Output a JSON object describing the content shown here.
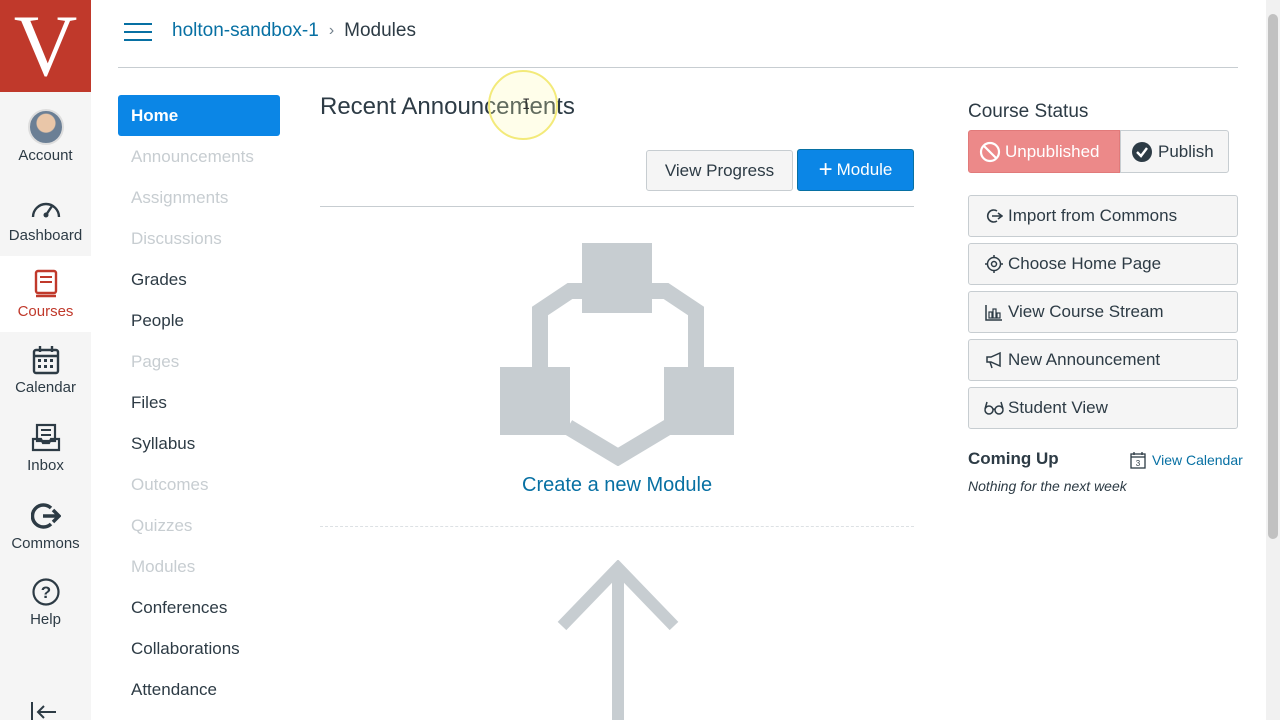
{
  "logo_letter": "V",
  "global_nav": {
    "account": "Account",
    "dashboard": "Dashboard",
    "courses": "Courses",
    "calendar": "Calendar",
    "inbox": "Inbox",
    "commons": "Commons",
    "help": "Help"
  },
  "breadcrumb": {
    "course": "holton-sandbox-1",
    "separator": "›",
    "current": "Modules"
  },
  "course_nav": {
    "items": [
      {
        "label": "Home",
        "state": "active"
      },
      {
        "label": "Announcements",
        "state": "disabled"
      },
      {
        "label": "Assignments",
        "state": "disabled"
      },
      {
        "label": "Discussions",
        "state": "disabled"
      },
      {
        "label": "Grades",
        "state": "enabled"
      },
      {
        "label": "People",
        "state": "enabled"
      },
      {
        "label": "Pages",
        "state": "disabled"
      },
      {
        "label": "Files",
        "state": "enabled"
      },
      {
        "label": "Syllabus",
        "state": "enabled"
      },
      {
        "label": "Outcomes",
        "state": "disabled"
      },
      {
        "label": "Quizzes",
        "state": "disabled"
      },
      {
        "label": "Modules",
        "state": "disabled"
      },
      {
        "label": "Conferences",
        "state": "enabled"
      },
      {
        "label": "Collaborations",
        "state": "enabled"
      },
      {
        "label": "Attendance",
        "state": "enabled"
      }
    ]
  },
  "main": {
    "recent_title": "Recent Announcements",
    "view_progress": "View Progress",
    "add_module_plus": "+",
    "add_module": "Module",
    "create_module_link": "Create a new Module"
  },
  "sidebar": {
    "status_title": "Course Status",
    "unpublished": "Unpublished",
    "publish": "Publish",
    "buttons": [
      {
        "label": "Import from Commons",
        "icon": "commons-icon"
      },
      {
        "label": "Choose Home Page",
        "icon": "target-icon"
      },
      {
        "label": "View Course Stream",
        "icon": "stream-icon"
      },
      {
        "label": "New Announcement",
        "icon": "megaphone-icon"
      },
      {
        "label": "Student View",
        "icon": "glasses-icon"
      }
    ],
    "coming_up": "Coming Up",
    "calendar_day": "3",
    "view_calendar": "View Calendar",
    "nothing": "Nothing for the next week"
  },
  "colors": {
    "brand": "#c0392b",
    "primary": "#0b86e6",
    "link": "#0770a3",
    "unpublished": "#ec8989"
  }
}
